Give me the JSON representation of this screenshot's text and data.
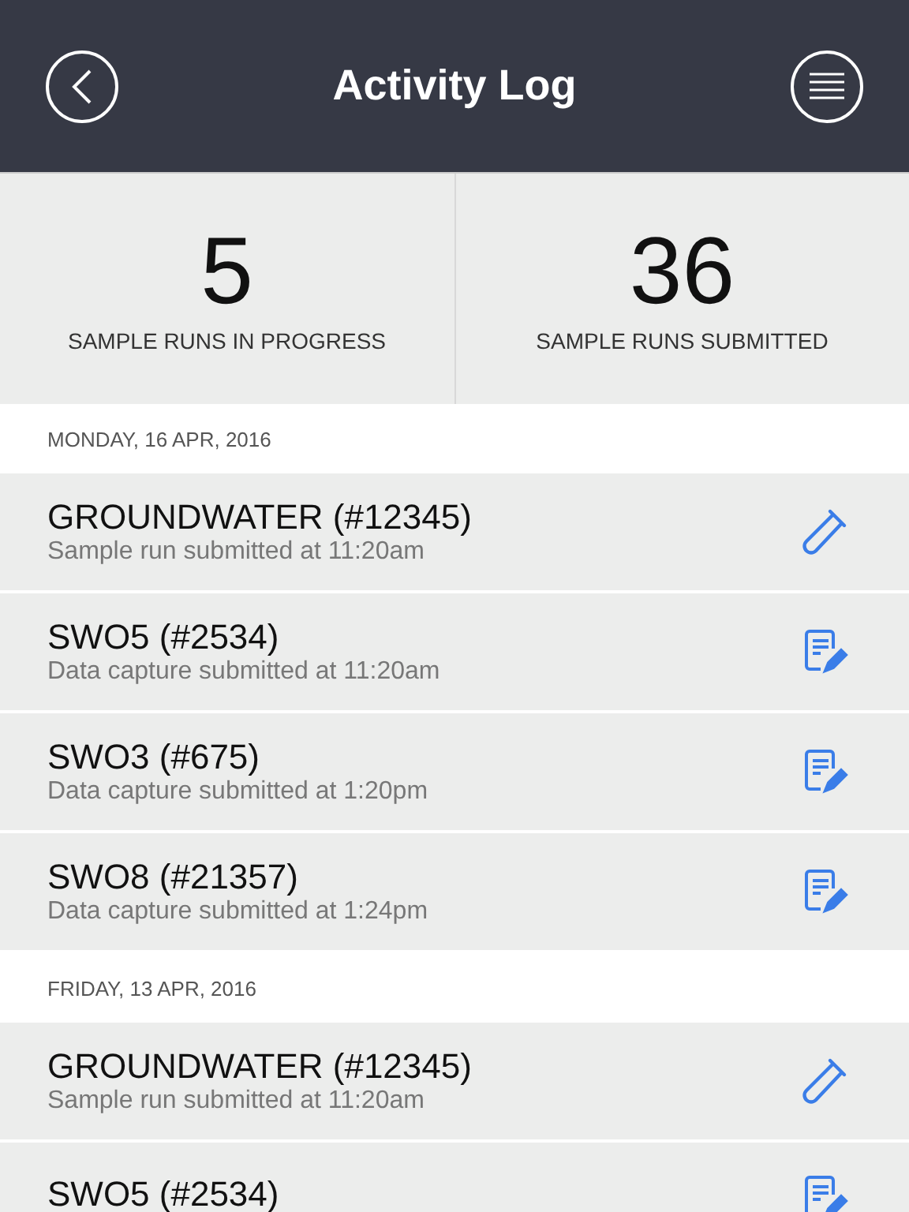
{
  "header": {
    "title": "Activity Log"
  },
  "stats": [
    {
      "value": "5",
      "label": "SAMPLE RUNS IN PROGRESS"
    },
    {
      "value": "36",
      "label": "SAMPLE RUNS SUBMITTED"
    }
  ],
  "days": [
    {
      "date": "MONDAY, 16 APR, 2016",
      "entries": [
        {
          "kind": "sample",
          "title": "GROUNDWATER (#12345)",
          "subtitle": "Sample run submitted at 11:20am"
        },
        {
          "kind": "data",
          "title": "SWO5 (#2534)",
          "subtitle": "Data capture submitted at 11:20am"
        },
        {
          "kind": "data",
          "title": "SWO3 (#675)",
          "subtitle": "Data capture submitted at 1:20pm"
        },
        {
          "kind": "data",
          "title": "SWO8 (#21357)",
          "subtitle": "Data capture submitted at 1:24pm"
        }
      ]
    },
    {
      "date": "FRIDAY, 13 APR, 2016",
      "entries": [
        {
          "kind": "sample",
          "title": "GROUNDWATER (#12345)",
          "subtitle": "Sample run submitted at 11:20am"
        },
        {
          "kind": "data",
          "title": "SWO5 (#2534)"
        }
      ]
    }
  ]
}
